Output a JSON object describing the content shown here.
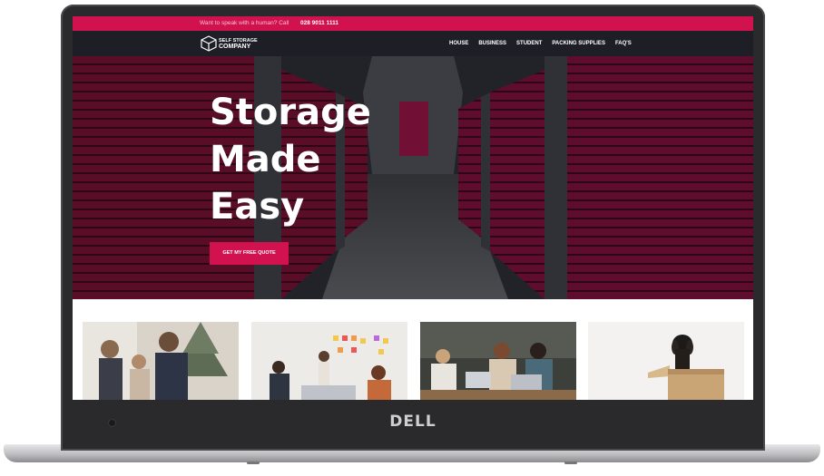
{
  "device": {
    "brand": "DELL"
  },
  "topbar": {
    "message": "Want to speak with a human? Call",
    "phone": "028 9011 1111"
  },
  "nav": {
    "logo_line1": "SELF STORAGE",
    "logo_line2": "COMPANY",
    "items": [
      {
        "label": "HOUSE"
      },
      {
        "label": "BUSINESS"
      },
      {
        "label": "STUDENT"
      },
      {
        "label": "PACKING SUPPLIES"
      },
      {
        "label": "FAQ'S"
      }
    ]
  },
  "hero": {
    "headline_lines": [
      "Storage",
      "Made",
      "Easy"
    ],
    "cta_label": "GET MY FREE QUOTE"
  },
  "cards": [
    {
      "icon": "family-photo"
    },
    {
      "icon": "office-meeting-photo"
    },
    {
      "icon": "students-laptops-photo"
    },
    {
      "icon": "dog-in-box-photo"
    }
  ],
  "colors": {
    "accent": "#d1124f",
    "nav_bg": "#1d1e26",
    "unit_door": "#7a1234"
  }
}
